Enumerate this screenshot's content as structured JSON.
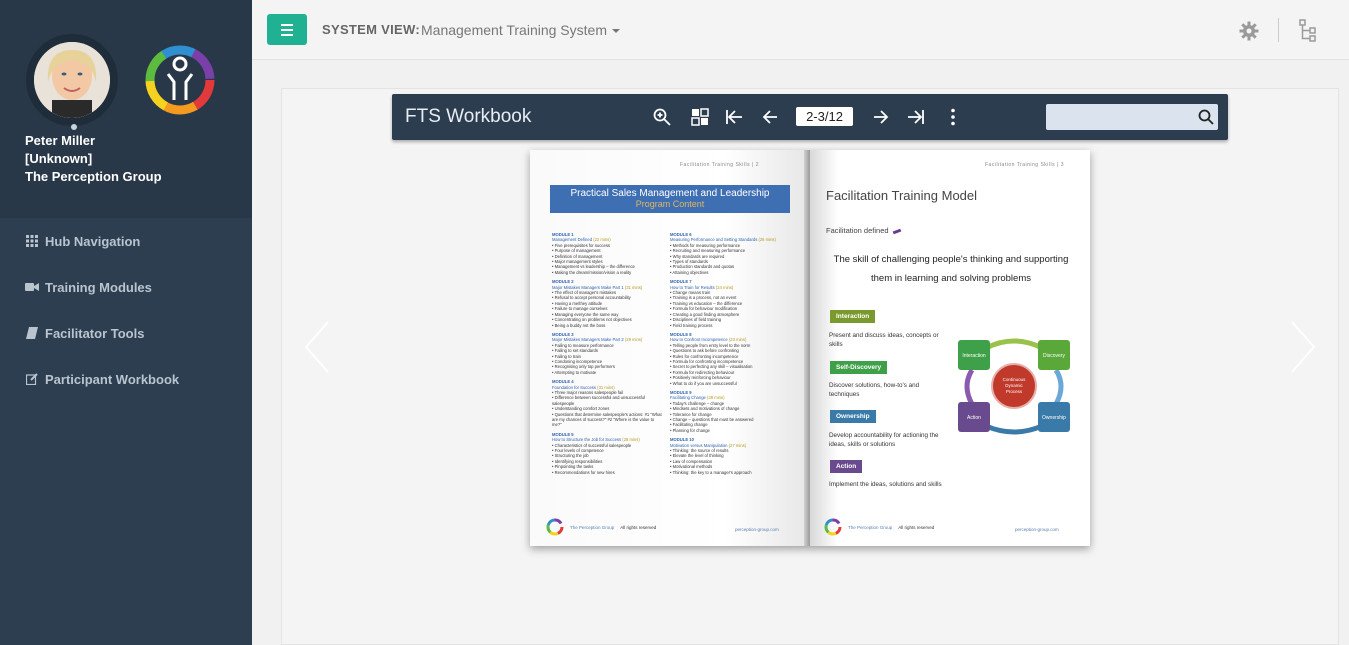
{
  "user": {
    "name": "Peter Miller",
    "role": "[Unknown]",
    "org": "The Perception Group"
  },
  "sidebar": {
    "items": [
      {
        "label": "Hub Navigation",
        "icon": "grid-icon"
      },
      {
        "label": "Training Modules",
        "icon": "video-camera-icon"
      },
      {
        "label": "Facilitator Tools",
        "icon": "book-icon"
      },
      {
        "label": "Participant Workbook",
        "icon": "edit-icon"
      }
    ]
  },
  "topbar": {
    "system_view_label": "SYSTEM VIEW:",
    "system_view_value": "Management Training System"
  },
  "viewer": {
    "title": "FTS Workbook",
    "page_indicator": "2-3/12",
    "search_placeholder": ""
  },
  "book": {
    "left": {
      "running_head": "Facilitation Training Skills | 2",
      "banner_title": "Practical Sales Management and Leadership",
      "banner_subtitle": "Program Content",
      "col1": [
        {
          "module": "MODULE 1",
          "title": "Management Defined",
          "dur": "(22 mins)",
          "items": [
            "Five prerequisites for success",
            "Purpose of management",
            "Definition of management",
            "Major management styles",
            "Management vs leadership – the difference",
            "Making the dream/mission/vision a reality"
          ]
        },
        {
          "module": "MODULE 2",
          "title": "Major Mistakes Managers Make Part 1",
          "dur": "(31 mins)",
          "items": [
            "The effect of manager's mistakes",
            "Refusal to accept personal accountability",
            "Having a me/they attitude",
            "Failure to manage ourselves",
            "Managing everyone the same way",
            "Concentrating on problems not objectives",
            "Being a buddy not the boss"
          ]
        },
        {
          "module": "MODULE 3",
          "title": "Major Mistakes Managers Make Part 2",
          "dur": "(29 mins)",
          "items": [
            "Failing to measure performance",
            "Failing to set standards",
            "Failing to train",
            "Condoning incompetence",
            "Recognising only top performers",
            "Attempting to motivate"
          ]
        },
        {
          "module": "MODULE 4",
          "title": "Foundation for Success",
          "dur": "(31 mins)",
          "items": [
            "Three major reasons salespeople fail",
            "Difference between successful and unsuccessful salespeople",
            "Understanding comfort zones",
            "Questions that determine salespeople's actions: #1 \"What are my chances of success?\" #2 \"Where is the value to me?\""
          ]
        },
        {
          "module": "MODULE 5",
          "title": "How to Structure the Job for Success",
          "dur": "(28 mins)",
          "items": [
            "Characteristics of successful salespeople",
            "Four levels of competence",
            "Structuring the job",
            "Identifying responsibilities",
            "Pinpointing the tasks",
            "Recommendations for new hires"
          ]
        }
      ],
      "col2": [
        {
          "module": "MODULE 6",
          "title": "Measuring Performance and Setting Standards",
          "dur": "(26 mins)",
          "items": [
            "Methods for measuring performance",
            "Recruiting and measuring performance",
            "Why standards are required",
            "Types of standards",
            "Production standards and quotas",
            "Attaining objectives"
          ]
        },
        {
          "module": "MODULE 7",
          "title": "How to Train for Results",
          "dur": "(24 mins)",
          "items": [
            "Change means train",
            "Training is a process, not an event",
            "Training vs education – the difference",
            "Formula for behaviour modification",
            "Creating a good finding atmosphere",
            "Disciplines of field training",
            "Field training process"
          ]
        },
        {
          "module": "MODULE 8",
          "title": "How to Confront Incompetence",
          "dur": "(23 mins)",
          "items": [
            "Telling people from entry level to the norm",
            "Questions to ask before confronting",
            "Rules for confronting incompetence",
            "Formula for confronting incompetence",
            "Secret to perfecting any skill – visualisation",
            "Formula for redirecting behaviour",
            "Positively reinforcing behaviour",
            "What to do if you are unsuccessful"
          ]
        },
        {
          "module": "MODULE 9",
          "title": "Facilitating Change",
          "dur": "(38 mins)",
          "items": [
            "Today's challenge – change",
            "Mindsets and motivations of change",
            "Tolerance for change",
            "Change – questions that must be answered",
            "Facilitating change",
            "Planning for change"
          ]
        },
        {
          "module": "MODULE 10",
          "title": "Motivation versus Manipulation",
          "dur": "(27 mins)",
          "items": [
            "Thinking: the source of results",
            "Elevate the level of thinking",
            "Law of compensation",
            "Motivational methods",
            "Thinking: the key to a manager's approach"
          ]
        }
      ],
      "footer_org": "The Perception Group",
      "footer_rights": "All rights reserved",
      "footer_url": "perception-group.com"
    },
    "right": {
      "running_head": "Facilitation Training Skills | 3",
      "title": "Facilitation Training Model",
      "definition_label": "Facilitation defined",
      "quote": "The skill of challenging people's thinking and supporting them in learning and solving problems",
      "stages": [
        {
          "label": "Interaction",
          "color": "#7a9a2e",
          "desc": "Present and discuss ideas, concepts or skills"
        },
        {
          "label": "Self-Discovery",
          "color": "#3fa04a",
          "desc": "Discover solutions, how-to's and techniques"
        },
        {
          "label": "Ownership",
          "color": "#3a7aa8",
          "desc": "Develop accountability for actioning the ideas, skills or solutions"
        },
        {
          "label": "Action",
          "color": "#6a4a8e",
          "desc": "Implement the ideas, solutions and skills"
        }
      ],
      "cycle": {
        "center": "Continuous Dynamic Process",
        "nodes": [
          "Interaction",
          "Discovery",
          "Ownership",
          "Action"
        ]
      },
      "footer_org": "The Perception Group",
      "footer_rights": "All rights reserved",
      "footer_url": "perception-group.com"
    }
  },
  "colors": {
    "sidebar_bg": "#2d3e50",
    "accent": "#1fb191",
    "viewer_bar": "#2c3d50"
  }
}
